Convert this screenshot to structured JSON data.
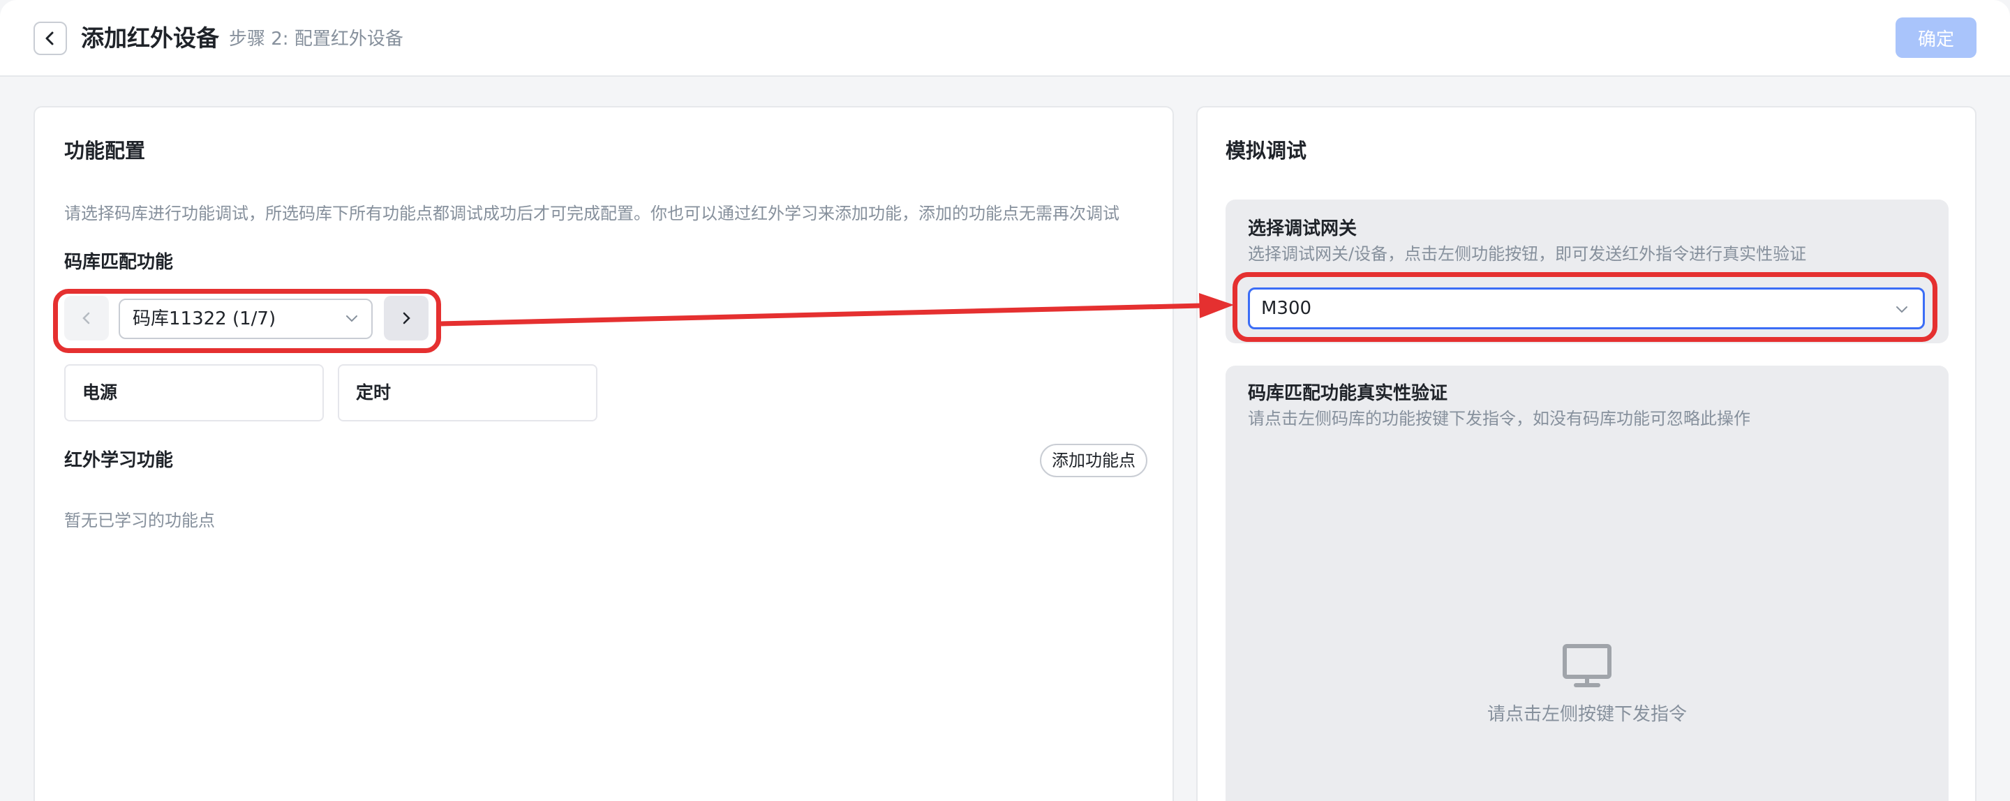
{
  "header": {
    "title": "添加红外设备",
    "subtitle": "步骤 2: 配置红外设备",
    "confirm_label": "确定"
  },
  "left_panel": {
    "title": "功能配置",
    "hint": "请选择码库进行功能调试，所选码库下所有功能点都调试成功后才可完成配置。你也可以通过红外学习来添加功能，添加的功能点无需再次调试",
    "library_section_title": "码库匹配功能",
    "library_select_value": "码库11322 (1/7)",
    "functions": [
      "电源",
      "定时"
    ],
    "ir_learning_title": "红外学习功能",
    "add_function_label": "添加功能点",
    "ir_empty_text": "暂无已学习的功能点"
  },
  "right_panel": {
    "title": "模拟调试",
    "gateway_title": "选择调试网关",
    "gateway_hint": "选择调试网关/设备，点击左侧功能按钮，即可发送红外指令进行真实性验证",
    "gateway_value": "M300",
    "verify_title": "码库匹配功能真实性验证",
    "verify_hint": "请点击左侧码库的功能按键下发指令，如没有码库功能可忽略此操作",
    "empty_text": "请点击左侧按键下发指令"
  },
  "colors": {
    "accent": "#3b6df6",
    "confirm_disabled": "#a9c4fb",
    "annotation_red": "#e53030"
  },
  "icons": [
    "back-arrow-icon",
    "chevron-left-icon",
    "chevron-right-icon",
    "chevron-down-icon",
    "monitor-icon"
  ]
}
